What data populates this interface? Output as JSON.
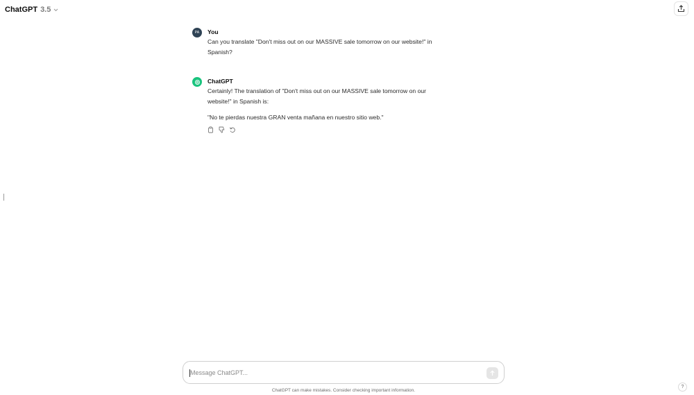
{
  "header": {
    "model_name": "ChatGPT",
    "model_version": "3.5"
  },
  "conversation": [
    {
      "author": "You",
      "avatar_initials": "PA",
      "lines": [
        "Can you translate \"Don't miss out on our MASSIVE sale tomorrow on our website!\" in",
        "Spanish?"
      ]
    },
    {
      "author": "ChatGPT",
      "lines": [
        "Certainly! The translation of \"Don't miss out on our MASSIVE sale tomorrow on our",
        "website!\" in Spanish is:"
      ],
      "translation": "\"No te pierdas nuestra GRAN venta mañana en nuestro sitio web.\""
    }
  ],
  "composer": {
    "placeholder": "Message ChatGPT...",
    "value": ""
  },
  "footer": {
    "disclaimer": "ChatGPT can make mistakes. Consider checking important information.",
    "help_label": "?"
  },
  "icons": {
    "model_dropdown": "chevron-down-icon",
    "share": "share-icon",
    "bot_avatar": "openai-logo-icon",
    "copy": "copy-icon",
    "thumbs_down": "thumbs-down-icon",
    "regenerate": "regenerate-icon",
    "send": "arrow-up-icon"
  },
  "colors": {
    "bot_avatar": "#19c37d",
    "user_avatar": "#2f4355",
    "send_button_disabled": "#e5e5e5"
  }
}
